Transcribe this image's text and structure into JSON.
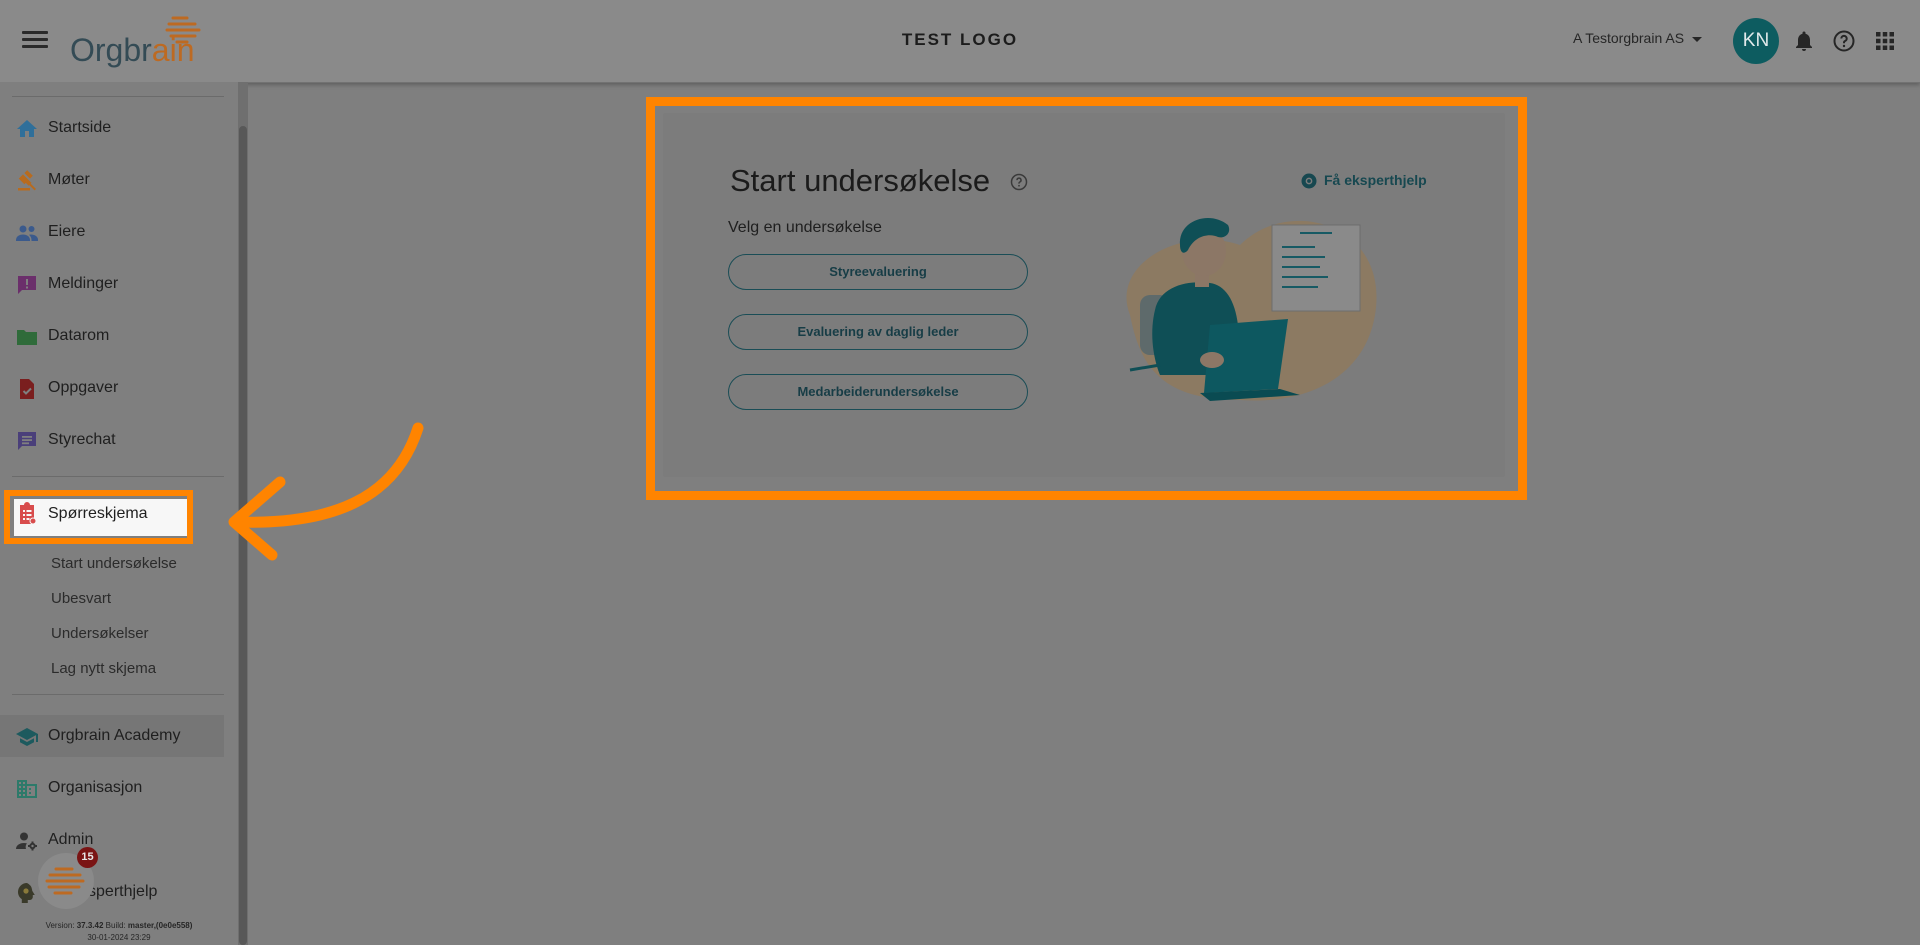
{
  "header": {
    "logo_text_a": "Orgbr",
    "logo_text_b": "ain",
    "center_logo": "TEST LOGO",
    "org_name": "A Testorgbrain AS",
    "avatar_initials": "KN"
  },
  "sidebar": {
    "items": [
      {
        "label": "Startside",
        "icon": "home-icon",
        "color": "#2f6f9a"
      },
      {
        "label": "Møter",
        "icon": "gavel-icon",
        "color": "#b86b1e"
      },
      {
        "label": "Eiere",
        "icon": "people-icon",
        "color": "#3b5a8c"
      },
      {
        "label": "Meldinger",
        "icon": "message-alert-icon",
        "color": "#6b2f6b"
      },
      {
        "label": "Datarom",
        "icon": "folder-icon",
        "color": "#2f6b3a"
      },
      {
        "label": "Oppgaver",
        "icon": "task-icon",
        "color": "#7a1e1e"
      },
      {
        "label": "Styrechat",
        "icon": "chat-icon",
        "color": "#4a3f7a"
      }
    ],
    "active": {
      "label": "Spørreskjema",
      "icon": "clipboard-icon",
      "color": "#d84c4c"
    },
    "sub_items": [
      "Start undersøkelse",
      "Ubesvart",
      "Undersøkelser",
      "Lag nytt skjema"
    ],
    "bottom_items": [
      {
        "label": "Orgbrain Academy",
        "icon": "school-icon",
        "color": "#1d5a5e"
      },
      {
        "label": "Organisasjon",
        "icon": "domain-icon",
        "color": "#2d7a6a"
      },
      {
        "label": "Admin",
        "icon": "admin-icon",
        "color": "#333333"
      },
      {
        "label": "Få eksperthjelp",
        "icon": "expert-help-icon",
        "color": "#3a3a2a"
      }
    ],
    "version_label": "Version:",
    "version": "37.3.42",
    "build_label": "Build:",
    "build": "master,(0e0e558)",
    "build_date": "30-01-2024 23:29",
    "chat_badge": "15"
  },
  "card": {
    "title": "Start undersøkelse",
    "subtitle": "Velg en undersøkelse",
    "buttons": [
      "Styreevaluering",
      "Evaluering av daglig leder",
      "Medarbeiderundersøkelse"
    ],
    "expert_link": "Få eksperthjelp"
  },
  "colors": {
    "highlight": "#ff8400",
    "teal": "#0d5c60"
  }
}
